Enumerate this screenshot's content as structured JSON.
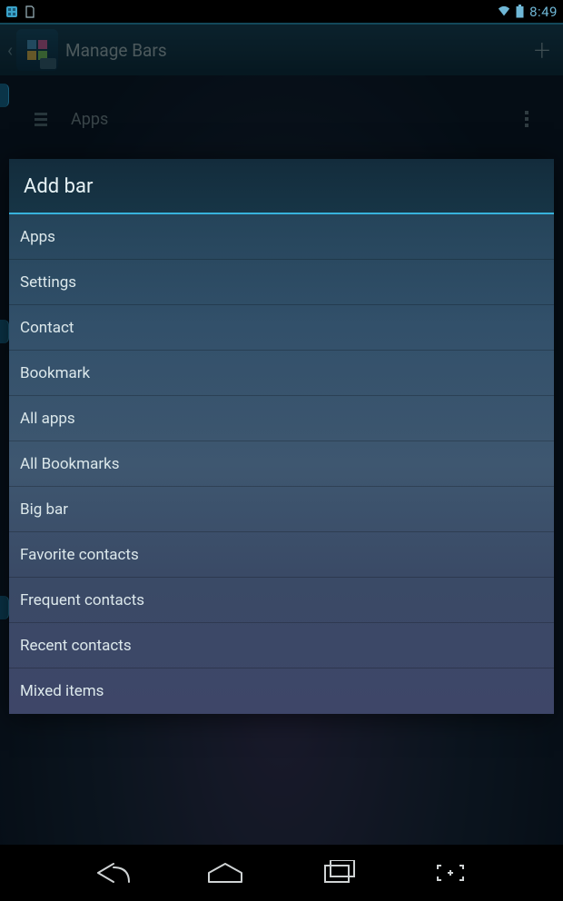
{
  "statusbar": {
    "time": "8:49",
    "icons": {
      "left_app": "app-notification-icon",
      "left_sd": "sd-card-icon",
      "wifi": "wifi-icon",
      "battery": "battery-icon"
    }
  },
  "actionbar": {
    "title": "Manage Bars",
    "back_icon": "chevron-left-icon",
    "app_icon": "app-icon",
    "add_icon": "plus-icon"
  },
  "background_row": {
    "label": "Apps",
    "drag_icon": "drag-handle-icon",
    "overflow_icon": "overflow-dots-icon"
  },
  "dialog": {
    "title": "Add bar",
    "items": [
      "Apps",
      "Settings",
      "Contact",
      "Bookmark",
      "All apps",
      "All Bookmarks",
      "Big bar",
      "Favorite contacts",
      "Frequent contacts",
      "Recent contacts",
      "Mixed items"
    ]
  },
  "navbar": {
    "back": "nav-back-icon",
    "home": "nav-home-icon",
    "recent": "nav-recent-icon",
    "screenshot": "nav-screenshot-icon"
  }
}
